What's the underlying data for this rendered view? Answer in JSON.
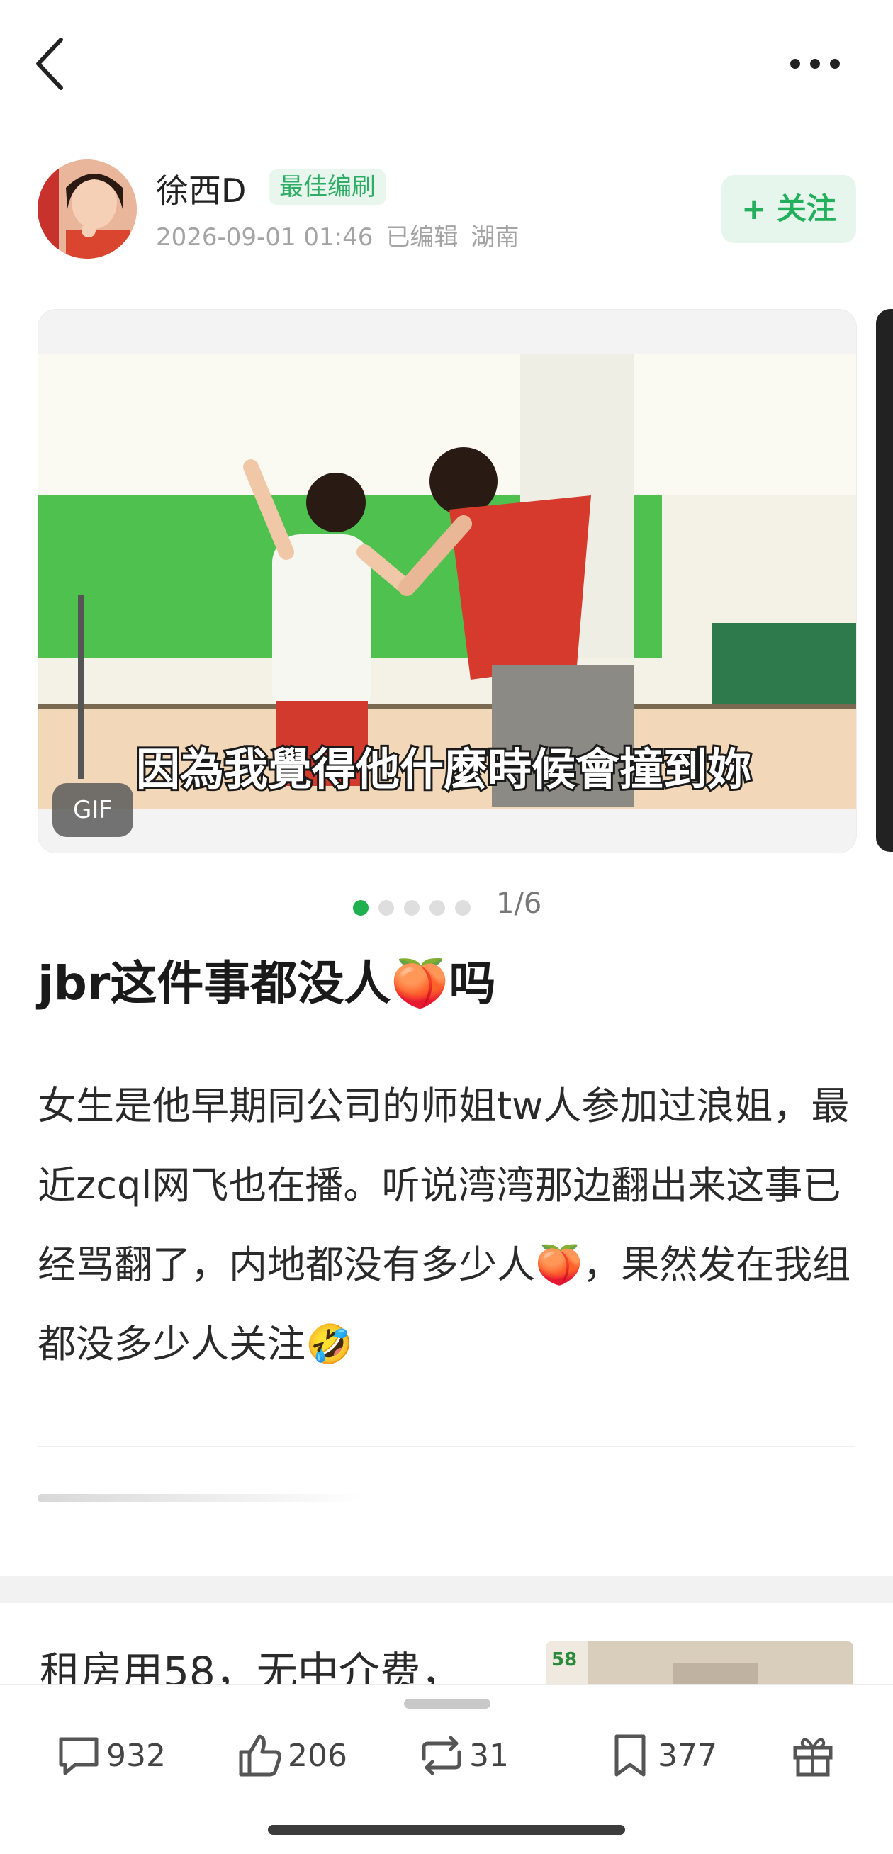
{
  "author": {
    "name": "徐西D",
    "badge": "最佳编刷",
    "time": "2026-09-01 01:46",
    "edited": "已编辑",
    "location": "湖南",
    "follow_label": "+ 关注"
  },
  "media": {
    "gif_label": "GIF",
    "subtitle": "因為我覺得他什麼時候會撞到妳",
    "page_indicator": "1/6",
    "dot_count": 5,
    "active_dot": 0
  },
  "post": {
    "title": "jbr这件事都没人🍑吗",
    "body": "女生是他早期同公司的师姐tw人参加过浪姐，最近zcql网飞也在播。听说湾湾那边翻出来这事已经骂翻了，内地都没有多少人🍑，果然发在我组都没多少人关注🤣"
  },
  "ad": {
    "text": "租房用58，无中介费，",
    "thumb_label": "58"
  },
  "actions": {
    "comments": "932",
    "likes": "206",
    "reposts": "31",
    "favorites": "377"
  },
  "icons": {
    "back": "back-icon",
    "more": "more-icon",
    "comment": "comment-icon",
    "like": "thumbs-up-icon",
    "repost": "repost-icon",
    "favorite": "bookmark-icon",
    "gift": "gift-icon"
  },
  "colors": {
    "accent": "#23b05c",
    "badge_bg": "#e8f6ee",
    "active_dot": "#1fb14f"
  }
}
